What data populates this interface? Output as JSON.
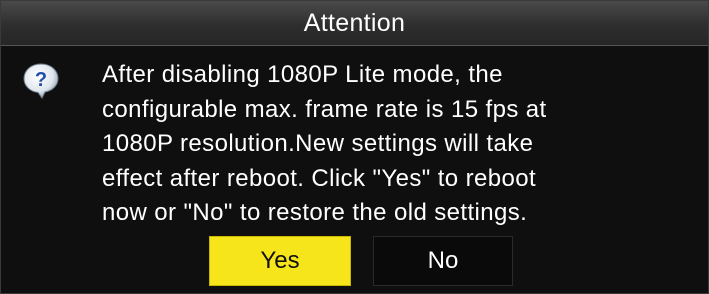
{
  "dialog": {
    "title": "Attention",
    "icon": "question-icon",
    "message_lines": [
      "After disabling 1080P Lite mode, the",
      "configurable max. frame rate is 15 fps at",
      "1080P resolution.New settings will take",
      "effect after reboot. Click \"Yes\" to reboot",
      "now or \"No\" to restore the old settings."
    ],
    "buttons": {
      "yes_label": "Yes",
      "no_label": "No"
    }
  },
  "colors": {
    "background": "#0f0f0f",
    "title_bar": "#2e2e2e",
    "text": "#ffffff",
    "yes_button": "#f7e51c",
    "no_button": "#0a0a0a"
  }
}
